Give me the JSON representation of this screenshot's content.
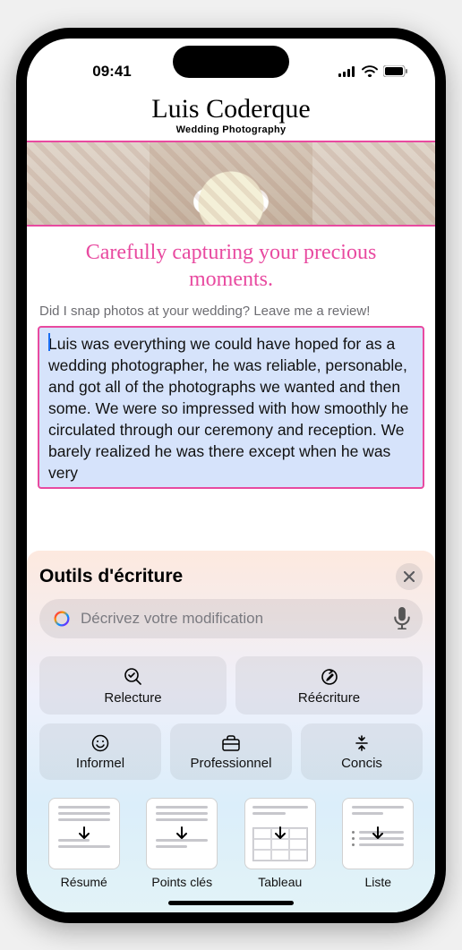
{
  "status": {
    "time": "09:41"
  },
  "page": {
    "title": "Luis Coderque",
    "subtitle": "Wedding Photography",
    "tagline": "Carefully capturing your precious moments.",
    "prompt": "Did I snap photos at your wedding? Leave me a review!",
    "review_text": "Luis was everything we could have hoped for as a wedding photographer, he was reliable, personable, and got all of the photographs we wanted and then some. We were so impressed with how smoothly he circulated through our ceremony and reception. We barely realized he was there except when he was very"
  },
  "panel": {
    "title": "Outils d'écriture",
    "input_placeholder": "Décrivez votre modification",
    "tools": {
      "proofread": "Relecture",
      "rewrite": "Réécriture",
      "friendly": "Informel",
      "professional": "Professionnel",
      "concise": "Concis"
    },
    "transforms": {
      "summary": "Résumé",
      "keypoints": "Points clés",
      "table": "Tableau",
      "list": "Liste"
    }
  }
}
